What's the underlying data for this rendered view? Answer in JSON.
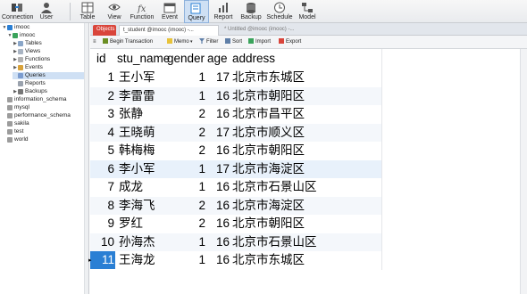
{
  "toolbar": {
    "buttons": [
      {
        "label": "Connection",
        "icon": "connection-icon"
      },
      {
        "label": "User",
        "icon": "user-icon"
      },
      {
        "label": "Table",
        "icon": "table-icon"
      },
      {
        "label": "View",
        "icon": "view-icon"
      },
      {
        "label": "Function",
        "icon": "function-icon"
      },
      {
        "label": "Event",
        "icon": "event-icon"
      },
      {
        "label": "Query",
        "icon": "query-icon"
      },
      {
        "label": "Report",
        "icon": "report-icon"
      },
      {
        "label": "Backup",
        "icon": "backup-icon"
      },
      {
        "label": "Schedule",
        "icon": "schedule-icon"
      },
      {
        "label": "Model",
        "icon": "model-icon"
      }
    ],
    "active": "Query"
  },
  "sidebar": {
    "items": [
      {
        "label": "imooc",
        "level": 0,
        "expanded": true
      },
      {
        "label": "imooc",
        "level": 1,
        "expanded": true
      },
      {
        "label": "Tables",
        "level": 2
      },
      {
        "label": "Views",
        "level": 2
      },
      {
        "label": "Functions",
        "level": 2
      },
      {
        "label": "Events",
        "level": 2
      },
      {
        "label": "Queries",
        "level": 2,
        "selected": true
      },
      {
        "label": "Reports",
        "level": 2
      },
      {
        "label": "Backups",
        "level": 2
      },
      {
        "label": "information_schema",
        "level": 1
      },
      {
        "label": "mysql",
        "level": 1
      },
      {
        "label": "performance_schema",
        "level": 1
      },
      {
        "label": "sakila",
        "level": 1
      },
      {
        "label": "test",
        "level": 1
      },
      {
        "label": "world",
        "level": 1
      }
    ]
  },
  "tabs": {
    "objects": "Objects",
    "student": "t_student @imooc (imooc) -...",
    "query": "* Untitled @imooc (imooc) -..."
  },
  "subtoolbar": {
    "begin_transaction": "Begin Transaction",
    "memo": "Memo",
    "filter": "Filter",
    "sort": "Sort",
    "import": "Import",
    "export": "Export"
  },
  "table": {
    "columns": [
      "id",
      "stu_name",
      "gender",
      "age",
      "address"
    ],
    "rows": [
      {
        "id": "1",
        "stu_name": "王小军",
        "gender": "1",
        "age": "17",
        "address": "北京市东城区"
      },
      {
        "id": "2",
        "stu_name": "李雷雷",
        "gender": "1",
        "age": "16",
        "address": "北京市朝阳区"
      },
      {
        "id": "3",
        "stu_name": "张静",
        "gender": "2",
        "age": "16",
        "address": "北京市昌平区"
      },
      {
        "id": "4",
        "stu_name": "王晓萌",
        "gender": "2",
        "age": "17",
        "address": "北京市顺义区"
      },
      {
        "id": "5",
        "stu_name": "韩梅梅",
        "gender": "2",
        "age": "16",
        "address": "北京市朝阳区"
      },
      {
        "id": "6",
        "stu_name": "李小军",
        "gender": "1",
        "age": "17",
        "address": "北京市海淀区"
      },
      {
        "id": "7",
        "stu_name": "成龙",
        "gender": "1",
        "age": "16",
        "address": "北京市石景山区"
      },
      {
        "id": "8",
        "stu_name": "李海飞",
        "gender": "2",
        "age": "16",
        "address": "北京市海淀区"
      },
      {
        "id": "9",
        "stu_name": "罗红",
        "gender": "2",
        "age": "16",
        "address": "北京市朝阳区"
      },
      {
        "id": "10",
        "stu_name": "孙海杰",
        "gender": "1",
        "age": "16",
        "address": "北京市石景山区"
      },
      {
        "id": "11",
        "stu_name": "王海龙",
        "gender": "1",
        "age": "16",
        "address": "北京市东城区"
      }
    ],
    "current_row_marker": "▸"
  },
  "colors": {
    "accent": "#2a7fd4",
    "objects_tab": "#d9453b"
  }
}
